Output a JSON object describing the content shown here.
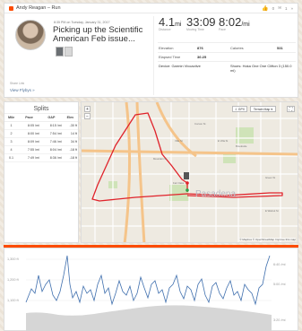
{
  "header": {
    "title": "Andy Reagan – Run",
    "kudos_count": "0",
    "comments_count": "1",
    "more": "»"
  },
  "activity": {
    "meta": "8:35 PM on Tuesday, January 31, 2017",
    "title": "Picking up the Scientific American Feb issue...",
    "share_label": "Share Link",
    "flybys_label": "View Flybys »"
  },
  "stats": {
    "distance": "4.1",
    "distance_unit": "mi",
    "distance_label": "Distance",
    "moving_time": "33:09",
    "moving_label": "Moving Time",
    "pace": "8:02",
    "pace_unit": "/mi",
    "pace_label": "Pace",
    "elevation_label": "Elevation",
    "elevation": "876",
    "calories_label": "Calories",
    "calories": "531",
    "elapsed_label": "Elapsed Time",
    "elapsed": "36:25",
    "device_label": "Device: Garmin Vivoactive",
    "shoes_label": "Shoes: Hoka One One Clifton 3 (150.0 mi)"
  },
  "splits": {
    "title": "Splits",
    "headers": [
      "Mile",
      "Pace",
      "GAP",
      "Elev"
    ],
    "rows": [
      [
        "1",
        "8:05 /mi",
        "8:15 /mi",
        "-30 ft"
      ],
      [
        "2",
        "8:00 /mi",
        "7:54 /mi",
        "14 ft"
      ],
      [
        "3",
        "8:09 /mi",
        "7:46 /mi",
        "34 ft"
      ],
      [
        "4",
        "7:55 /mi",
        "8:04 /mi",
        "-18 ft"
      ],
      [
        "0.1",
        "7:49 /mi",
        "8:36 /mi",
        "-18 ft"
      ]
    ]
  },
  "map": {
    "zoom_in": "+",
    "zoom_out": "−",
    "gpx_label": "GPX",
    "terrain_label": "Terrain Map",
    "fullscreen": "⛶",
    "city_label": "Pasadena",
    "attribution": "© Mapbox © OpenStreetMap Improve this map",
    "street_labels": [
      "Villa St",
      "E Villa St",
      "Corson St",
      "Brookside",
      "Mountain St",
      "Fair Oaks",
      "Green St",
      "E Walnut St"
    ],
    "route_color": "#e0232b"
  },
  "elevation": {
    "left_ticks": [
      "1,300 ft",
      "1,200 ft",
      "1,100 ft"
    ],
    "right_ticks": [
      "6:40 /mi",
      "5:00 /mi",
      "3:20 /mi"
    ],
    "pace_line_color": "#3f6fae",
    "fill_color": "#d6d6d6"
  }
}
